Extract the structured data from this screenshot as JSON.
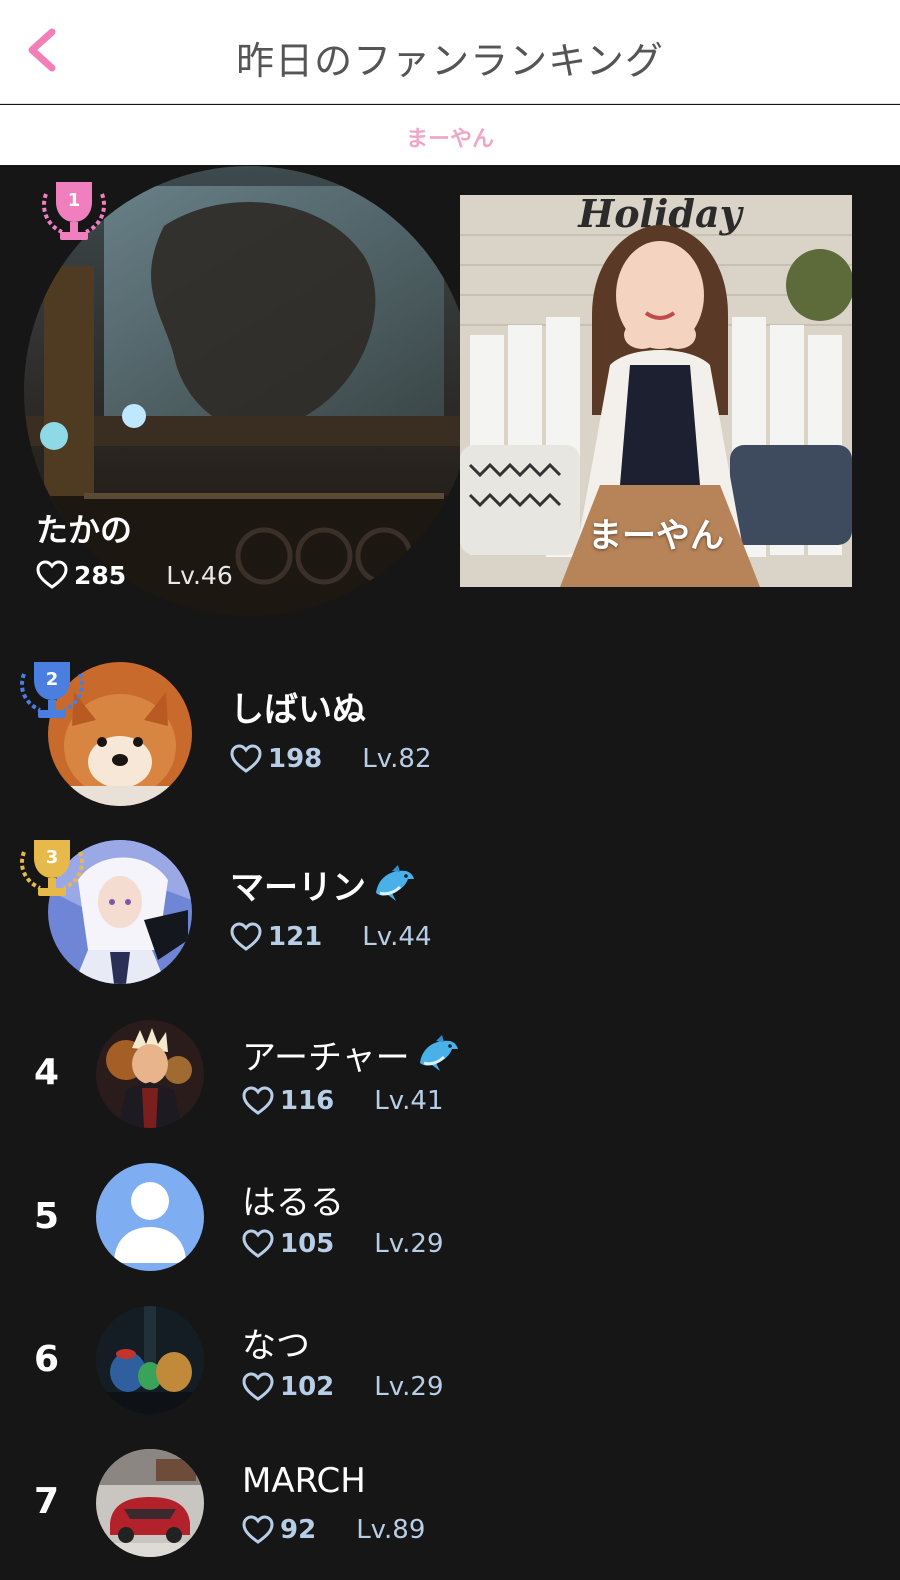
{
  "header": {
    "title": "昨日のファンランキング"
  },
  "subbar": {
    "name": "まーやん"
  },
  "top": {
    "rank": "1",
    "name": "たかの",
    "likes": "285",
    "level": "Lv.46",
    "image_text": "Holiday"
  },
  "streamer": {
    "name": "まーやん"
  },
  "ranks": [
    {
      "rank": "2",
      "name": "しばいぬ",
      "likes": "198",
      "level": "Lv.82"
    },
    {
      "rank": "3",
      "name": "マーリン",
      "likes": "121",
      "level": "Lv.44"
    },
    {
      "rank": "4",
      "name": "アーチャー",
      "likes": "116",
      "level": "Lv.41"
    },
    {
      "rank": "5",
      "name": "はるる",
      "likes": "105",
      "level": "Lv.29"
    },
    {
      "rank": "6",
      "name": "なつ",
      "likes": "102",
      "level": "Lv.29"
    },
    {
      "rank": "7",
      "name": "MARCH",
      "likes": "92",
      "level": "Lv.89"
    }
  ],
  "colors": {
    "accent": "#f27fb8",
    "background": "#161616",
    "gold": "#e7b94a",
    "blue": "#4a7fe0",
    "pink": "#ef7fbf"
  }
}
